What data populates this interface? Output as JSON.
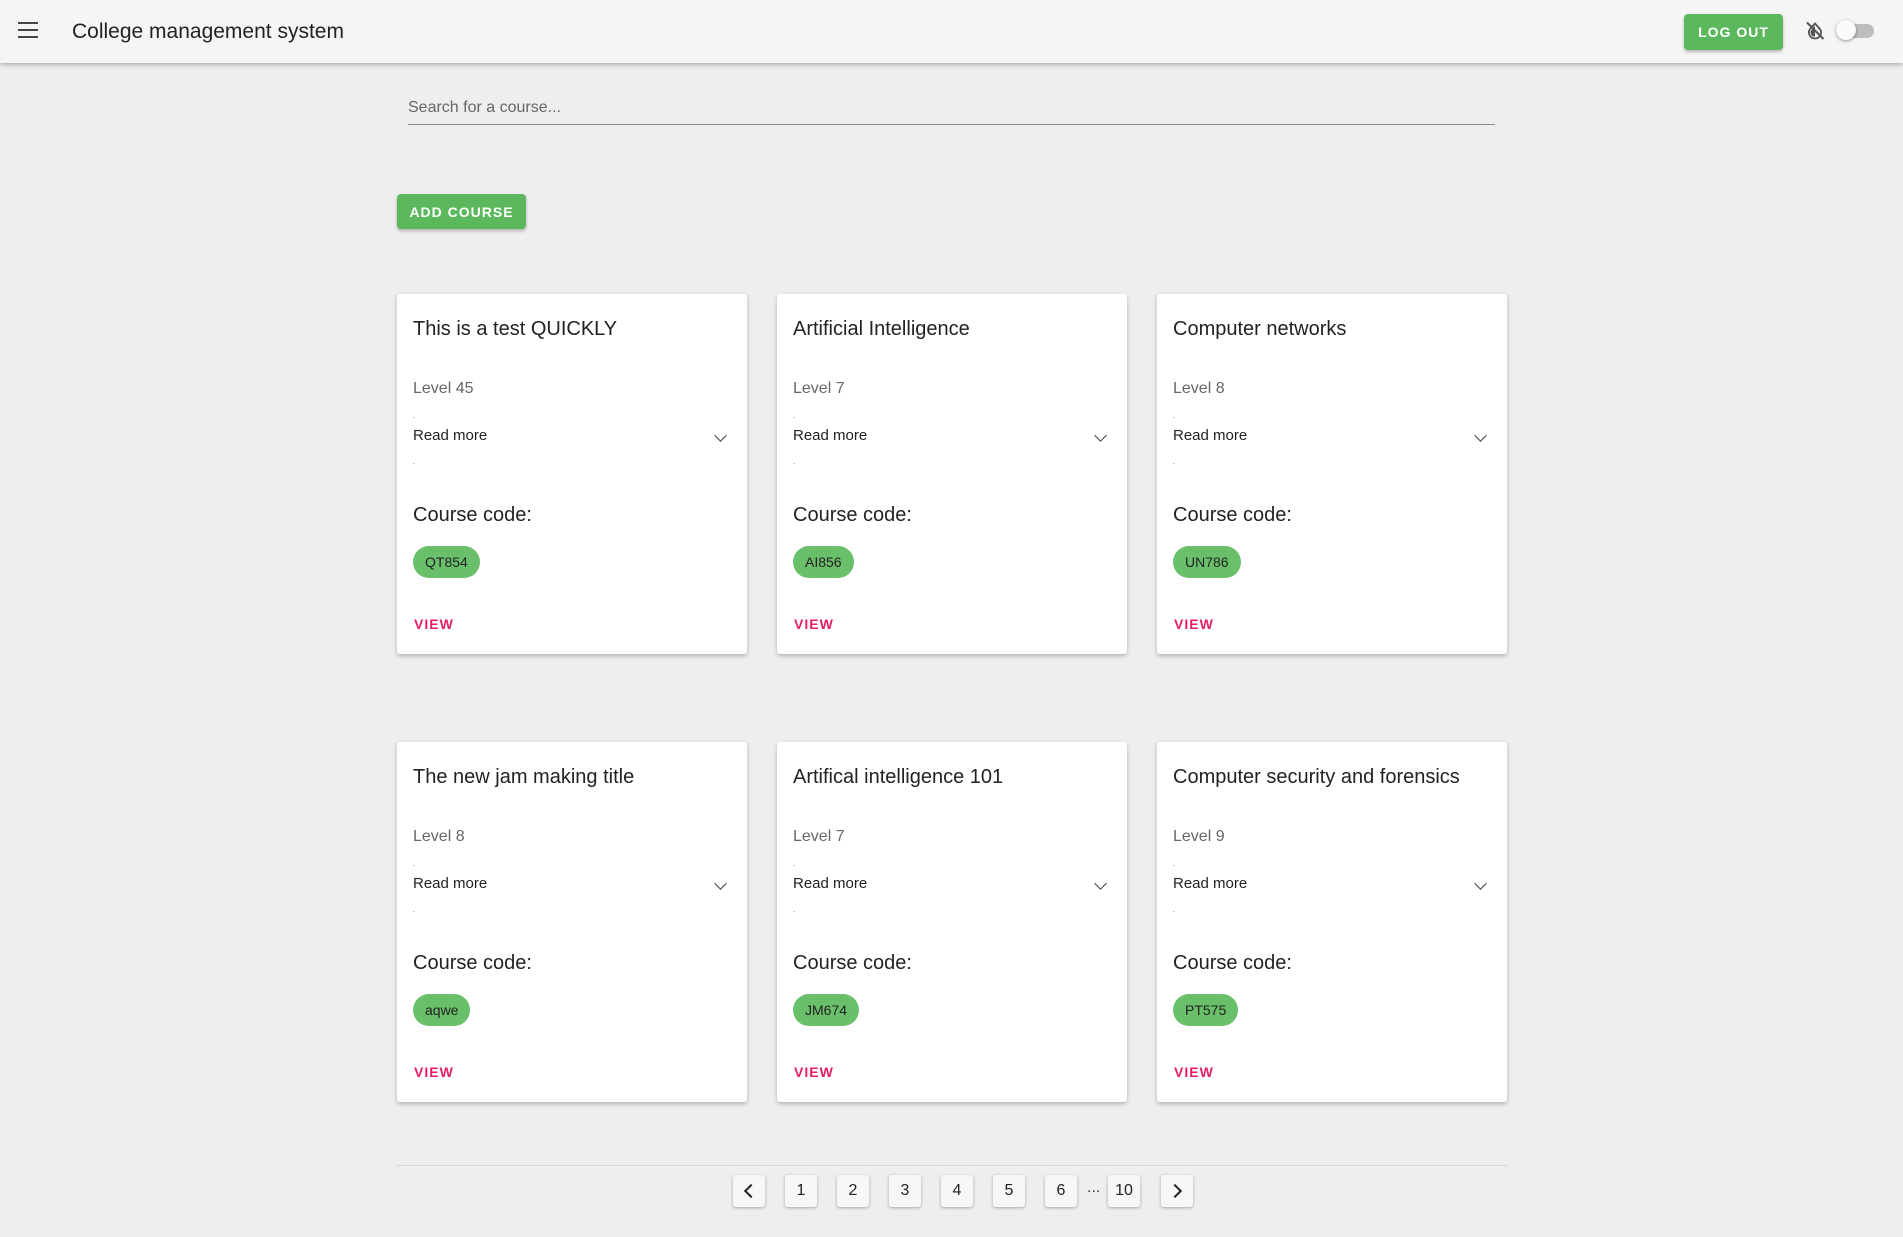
{
  "appbar": {
    "title": "College management system",
    "logout_label": "LOG OUT"
  },
  "search": {
    "placeholder": "Search for a course..."
  },
  "actions": {
    "add_course_label": "ADD COURSE"
  },
  "courses": [
    {
      "title": "This is a test QUICKLY",
      "level": "Level 45",
      "read_more": "Read more",
      "code_label": "Course code:",
      "code": "QT854",
      "view_label": "VIEW"
    },
    {
      "title": "Artificial Intelligence",
      "level": "Level 7",
      "read_more": "Read more",
      "code_label": "Course code:",
      "code": "AI856",
      "view_label": "VIEW"
    },
    {
      "title": "Computer networks",
      "level": "Level 8",
      "read_more": "Read more",
      "code_label": "Course code:",
      "code": "UN786",
      "view_label": "VIEW"
    },
    {
      "title": "The new jam making title",
      "level": "Level 8",
      "read_more": "Read more",
      "code_label": "Course code:",
      "code": "aqwe",
      "view_label": "VIEW"
    },
    {
      "title": "Artifical intelligence 101",
      "level": "Level 7",
      "read_more": "Read more",
      "code_label": "Course code:",
      "code": "JM674",
      "view_label": "VIEW"
    },
    {
      "title": "Computer security and forensics",
      "level": "Level 9",
      "read_more": "Read more",
      "code_label": "Course code:",
      "code": "PT575",
      "view_label": "VIEW"
    }
  ],
  "pagination": {
    "pages": [
      "1",
      "2",
      "3",
      "4",
      "5",
      "6"
    ],
    "ellipsis": "...",
    "last": "10"
  },
  "colors": {
    "primary": "#5cb85c",
    "chip": "#6abf6a",
    "accent": "#e91e63",
    "background": "#eeeeee"
  },
  "icons": {
    "menu": "menu-icon",
    "theme": "invert-colors-off-icon",
    "expand": "chevron-down-icon"
  }
}
